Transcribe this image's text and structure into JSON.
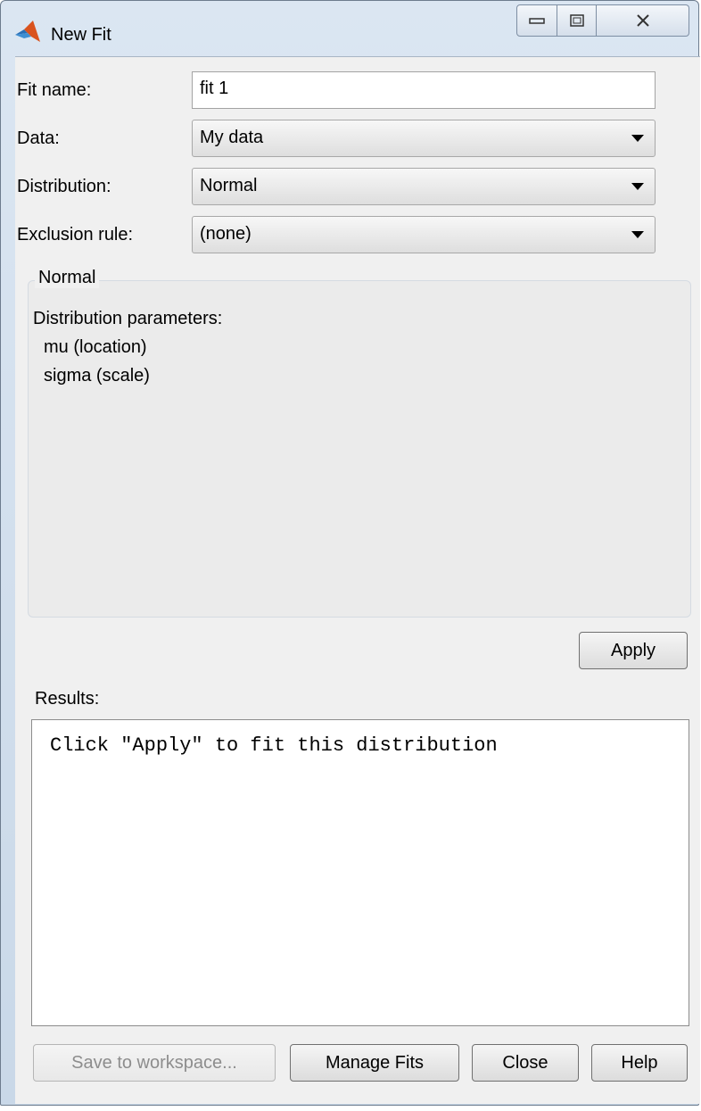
{
  "window": {
    "title": "New Fit",
    "controls": [
      "minimize-icon",
      "maximize-icon",
      "close-icon"
    ]
  },
  "form": {
    "fit_name_label": "Fit name:",
    "fit_name_value": "fit 1",
    "data_label": "Data:",
    "data_value": "My data",
    "distribution_label": "Distribution:",
    "distribution_value": "Normal",
    "exclusion_label": "Exclusion rule:",
    "exclusion_value": "(none)"
  },
  "panel": {
    "title": "Normal",
    "heading": "Distribution parameters:",
    "params": [
      "mu (location)",
      "sigma (scale)"
    ]
  },
  "apply_label": "Apply",
  "results": {
    "label": "Results:",
    "text": "Click \"Apply\" to fit this distribution"
  },
  "footer": {
    "save_label": "Save to workspace...",
    "manage_label": "Manage Fits",
    "close_label": "Close",
    "help_label": "Help"
  },
  "colors": {
    "titlebar": "#c9d8e8",
    "background": "#f0f0f0",
    "app_icon": "#d9531e"
  }
}
